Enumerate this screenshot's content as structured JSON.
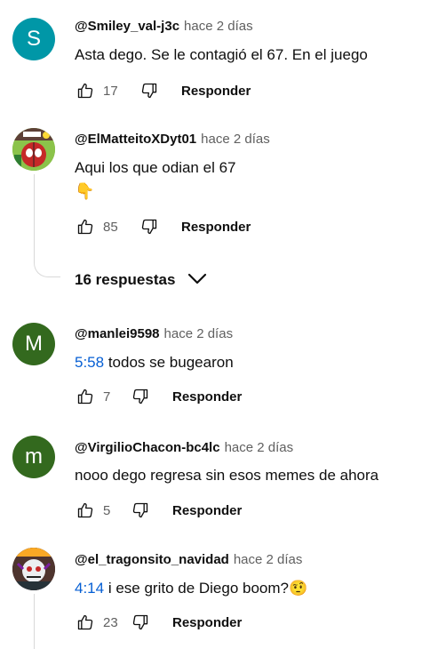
{
  "comments": [
    {
      "avatar_letter": "S",
      "avatar_color": "#0097a7",
      "author": "@Smiley_val-j3c",
      "time": "hace 2 días",
      "text": "Asta dego. Se le contagió el 67. En el juego",
      "likes": "17",
      "reply": "Responder"
    },
    {
      "author": "@ElMatteitoXDyt01",
      "time": "hace 2 días",
      "text": "Aqui los que odian el 67",
      "emoji": "👇",
      "likes": "85",
      "reply": "Responder"
    },
    {
      "avatar_letter": "M",
      "avatar_color": "#33691e",
      "author": "@manlei9598",
      "time": "hace 2 días",
      "timestamp": "5:58",
      "text": " todos se bugearon",
      "likes": "7",
      "reply": "Responder"
    },
    {
      "avatar_letter": "m",
      "avatar_color": "#33691e",
      "author": "@VirgilioChacon-bc4lc",
      "time": "hace 2 días",
      "text": "nooo dego regresa sin esos  memes de ahora",
      "likes": "5",
      "reply": "Responder"
    },
    {
      "author": "@el_tragonsito_navidad",
      "time": "hace 2 días",
      "timestamp": "4:14",
      "text": "  i ese grito de Diego boom?",
      "emoji": "🤨",
      "likes": "23",
      "reply": "Responder"
    }
  ],
  "replies_toggle": {
    "label": "16 respuestas"
  },
  "icons": {
    "like": "thumbs-up-icon",
    "dislike": "thumbs-down-icon",
    "expand": "chevron-down-icon"
  }
}
